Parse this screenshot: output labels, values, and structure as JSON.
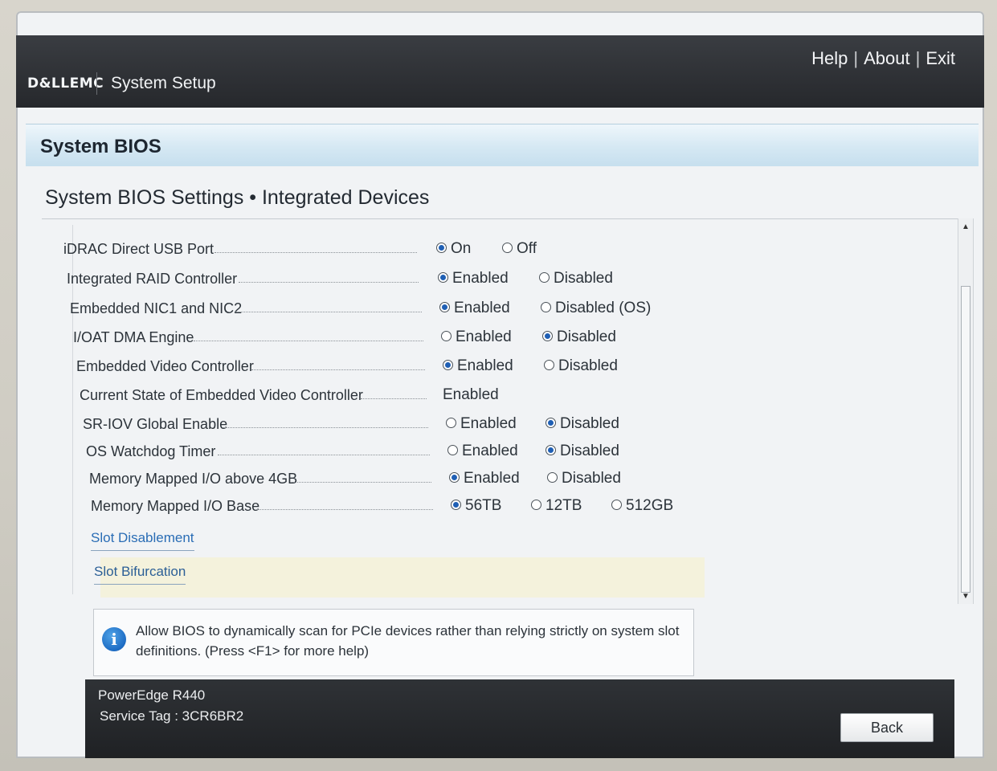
{
  "header": {
    "logo": "D&LLEMC",
    "app_title": "System Setup",
    "links": {
      "help": "Help",
      "about": "About",
      "exit": "Exit",
      "separator": "|"
    }
  },
  "section": {
    "title": "System BIOS"
  },
  "page": {
    "subtitle": "System BIOS Settings • Integrated Devices"
  },
  "settings": [
    {
      "label": "iDRAC Direct USB Port",
      "options": [
        "On",
        "Off"
      ],
      "selected": 0
    },
    {
      "label": "Integrated RAID Controller",
      "options": [
        "Enabled",
        "Disabled"
      ],
      "selected": 0
    },
    {
      "label": "Embedded NIC1 and NIC2",
      "options": [
        "Enabled",
        "Disabled (OS)"
      ],
      "selected": 0
    },
    {
      "label": "I/OAT DMA Engine",
      "options": [
        "Enabled",
        "Disabled"
      ],
      "selected": 1
    },
    {
      "label": "Embedded Video Controller",
      "options": [
        "Enabled",
        "Disabled"
      ],
      "selected": 0
    },
    {
      "label": "Current State of Embedded Video Controller",
      "value": "Enabled"
    },
    {
      "label": "SR-IOV Global Enable",
      "options": [
        "Enabled",
        "Disabled"
      ],
      "selected": 1
    },
    {
      "label": "OS Watchdog Timer",
      "options": [
        "Enabled",
        "Disabled"
      ],
      "selected": 1
    },
    {
      "label": "Memory Mapped I/O above 4GB",
      "options": [
        "Enabled",
        "Disabled"
      ],
      "selected": 0
    },
    {
      "label": "Memory Mapped I/O Base",
      "options": [
        "56TB",
        "12TB",
        "512GB"
      ],
      "selected": 0
    }
  ],
  "links": {
    "slot_disablement": "Slot Disablement",
    "slot_bifurcation": "Slot Bifurcation"
  },
  "help": {
    "icon": "info-icon",
    "text": "Allow BIOS to dynamically scan for PCIe devices rather than relying strictly on system slot definitions. (Press <F1> for more help)"
  },
  "footer": {
    "model": "PowerEdge R440",
    "service_tag": "Service Tag : 3CR6BR2",
    "back_label": "Back"
  }
}
